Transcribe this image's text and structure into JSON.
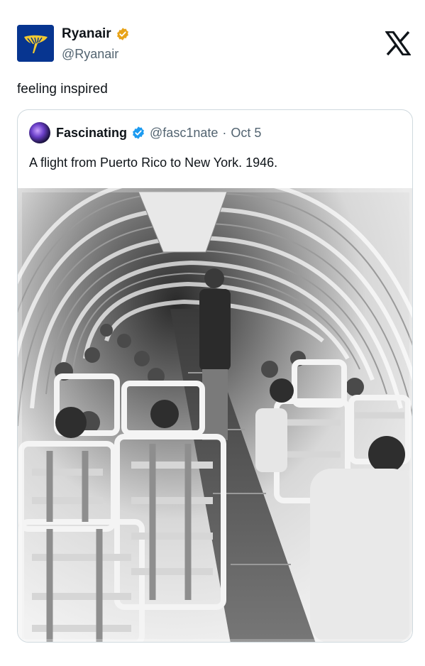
{
  "author": {
    "name": "Ryanair",
    "handle": "@Ryanair",
    "verified": true,
    "badge_color": "#e8a317",
    "avatar_color": "#073590",
    "avatar_icon": "ryanair-harp-logo-icon"
  },
  "platform_icon": "x-logo-icon",
  "tweet": {
    "text": "feeling inspired"
  },
  "quoted_tweet": {
    "author": {
      "name": "Fascinating",
      "handle": "@fasc1nate",
      "verified": true,
      "badge_color": "#1d9bf0",
      "avatar_icon": "galaxy-avatar-icon"
    },
    "separator": "·",
    "date": "Oct 5",
    "text": "A flight from Puerto Rico to New York. 1946.",
    "media": {
      "type": "photo",
      "style": "black-and-white",
      "icon": "vintage-airplane-cabin-photo"
    }
  }
}
